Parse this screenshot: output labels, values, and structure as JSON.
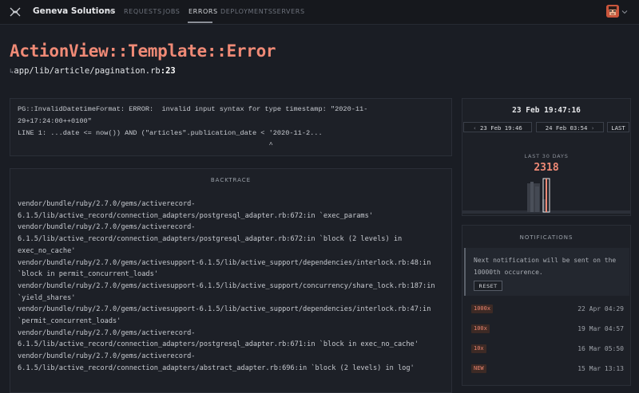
{
  "header": {
    "brand": "Geneva Solutions",
    "nav": [
      {
        "label": "REQUESTS",
        "active": false
      },
      {
        "label": "JOBS",
        "active": false
      },
      {
        "label": "ERRORS",
        "active": true
      },
      {
        "label": "DEPLOYMENTS",
        "active": false
      },
      {
        "label": "SERVERS",
        "active": false
      }
    ]
  },
  "error": {
    "title": "ActionView::Template::Error",
    "path_arrow": "↳",
    "path": "app/lib/article/pagination.rb",
    "line": ":23",
    "message": "PG::InvalidDatetimeFormat: ERROR:  invalid input syntax for type timestamp: \"2020-11-29+17:24:00++0100\"\nLINE 1: ...date <= now()) AND (\"articles\".publication_date < '2020-11-2...\n                                                             ^"
  },
  "backtrace": {
    "heading": "BACKTRACE",
    "lines": [
      "vendor/bundle/ruby/2.7.0/gems/activerecord-6.1.5/lib/active_record/connection_adapters/postgresql_adapter.rb:672:in `exec_params'",
      "vendor/bundle/ruby/2.7.0/gems/activerecord-6.1.5/lib/active_record/connection_adapters/postgresql_adapter.rb:672:in `block (2 levels) in exec_no_cache'",
      "vendor/bundle/ruby/2.7.0/gems/activesupport-6.1.5/lib/active_support/dependencies/interlock.rb:48:in `block in permit_concurrent_loads'",
      "vendor/bundle/ruby/2.7.0/gems/activesupport-6.1.5/lib/active_support/concurrency/share_lock.rb:187:in `yield_shares'",
      "vendor/bundle/ruby/2.7.0/gems/activesupport-6.1.5/lib/active_support/dependencies/interlock.rb:47:in `permit_concurrent_loads'",
      "vendor/bundle/ruby/2.7.0/gems/activerecord-6.1.5/lib/active_record/connection_adapters/postgresql_adapter.rb:671:in `block in exec_no_cache'",
      "vendor/bundle/ruby/2.7.0/gems/activerecord-6.1.5/lib/active_record/connection_adapters/abstract_adapter.rb:696:in `block (2 levels) in log'"
    ]
  },
  "timeline": {
    "current": "23 Feb 19:47:16",
    "prev_label": "23 Feb 19:46",
    "next_label": "24 Feb 03:54",
    "last_label": "LAST",
    "prev_icon": "chevron-left-icon",
    "next_icon": "chevron-right-icon"
  },
  "stats": {
    "label": "LAST 30 DAYS",
    "count": "2318"
  },
  "notifications": {
    "heading": "NOTIFICATIONS",
    "message": "Next notification will be sent on the 10000th occurence.",
    "reset_label": "RESET",
    "items": [
      {
        "badge": "1000x",
        "date": "22 Apr 04:29"
      },
      {
        "badge": "100x",
        "date": "19 Mar 04:57"
      },
      {
        "badge": "10x",
        "date": "16 Mar 05:50"
      },
      {
        "badge": "NEW",
        "date": "15 Mar 13:13"
      }
    ]
  },
  "colors": {
    "accent": "#f08a76",
    "background": "#1a1d24",
    "panel": "#1d2027"
  }
}
